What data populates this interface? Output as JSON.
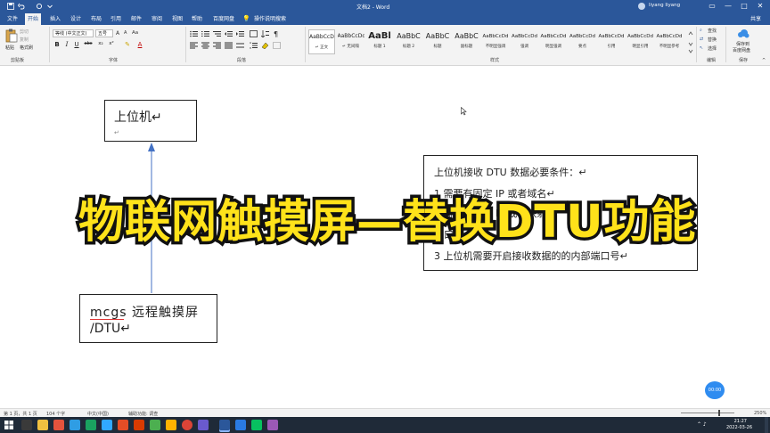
{
  "window": {
    "title": "文档2  -  Word",
    "user_name": "liyang liyang",
    "share": "共享",
    "minimize": "—",
    "maximize": "□",
    "close": "✕"
  },
  "tabs": [
    {
      "label": "文件",
      "active": false
    },
    {
      "label": "开始",
      "active": true
    },
    {
      "label": "插入",
      "active": false
    },
    {
      "label": "设计",
      "active": false
    },
    {
      "label": "布局",
      "active": false
    },
    {
      "label": "引用",
      "active": false
    },
    {
      "label": "邮件",
      "active": false
    },
    {
      "label": "审阅",
      "active": false
    },
    {
      "label": "视图",
      "active": false
    },
    {
      "label": "帮助",
      "active": false
    },
    {
      "label": "百度网盘",
      "active": false
    },
    {
      "label": "操作说明搜索",
      "active": false
    }
  ],
  "ribbon": {
    "clipboard": {
      "paste": "粘贴",
      "cut": "剪切",
      "copy": "复制",
      "format_painter": "格式刷",
      "label": "剪贴板"
    },
    "font": {
      "name": "等线 (中文正文)",
      "size": "五号",
      "bold": "B",
      "italic": "I",
      "underline": "U",
      "strike": "abc",
      "sub": "x₂",
      "sup": "x²",
      "color": "A",
      "aa": "Aa",
      "grow": "A",
      "label": "字体"
    },
    "paragraph": {
      "label": "段落"
    },
    "styles": {
      "label": "样式",
      "items": [
        {
          "sample": "AaBbCcDd",
          "name": "↵ 正文",
          "size": "6px",
          "bold": false
        },
        {
          "sample": "AaBbCcDd",
          "name": "↵ 无间隔",
          "size": "6px",
          "bold": false
        },
        {
          "sample": "AaBl",
          "name": "标题 1",
          "size": "10px",
          "bold": true
        },
        {
          "sample": "AaBbC",
          "name": "标题 2",
          "size": "8px",
          "bold": false
        },
        {
          "sample": "AaBbC",
          "name": "标题",
          "size": "8px",
          "bold": false
        },
        {
          "sample": "AaBbC",
          "name": "副标题",
          "size": "8px",
          "bold": false
        },
        {
          "sample": "AaBbCcDd",
          "name": "不明显强调",
          "size": "5.5px",
          "bold": false
        },
        {
          "sample": "AaBbCcDd",
          "name": "强调",
          "size": "5.5px",
          "bold": false
        },
        {
          "sample": "AaBbCcDd",
          "name": "明显强调",
          "size": "5.5px",
          "bold": false
        },
        {
          "sample": "AaBbCcDd",
          "name": "要点",
          "size": "5.5px",
          "bold": false
        },
        {
          "sample": "AaBbCcDd",
          "name": "引用",
          "size": "5.5px",
          "bold": false
        },
        {
          "sample": "AaBbCcDd",
          "name": "明显引用",
          "size": "5.5px",
          "bold": false
        },
        {
          "sample": "AaBbCcDd",
          "name": "不明显参考",
          "size": "5.5px",
          "bold": false
        }
      ]
    },
    "editing": {
      "find": "查找",
      "replace": "替换",
      "select": "选择",
      "label": "编辑"
    },
    "save": {
      "line1": "保存到",
      "line2": "百度网盘",
      "label": "保存"
    }
  },
  "document": {
    "box1": {
      "title": "上位机↵",
      "subline": "↵"
    },
    "box2": {
      "line1": "mcgs 远程触摸屏",
      "line2": "/DTU↵"
    },
    "box3": {
      "heading": "上位机接收 DTU 数据必要条件：↵",
      "item1": "1 需要有固定 IP 或者域名↵",
      "item2": "2 需要有公网 IP 或者映射↵",
      "item3": "端口号↵",
      "item4": "3 上位机需要开启接收数据的的内部端口号↵"
    }
  },
  "overlay": {
    "text": "物联网触摸屏—替换DTU功能"
  },
  "status": {
    "page": "第 1 页，共 1 页",
    "words": "104 个字",
    "lang": "中文(中国)",
    "access": "辅助功能: 调查",
    "zoom": "250%"
  },
  "recording_badge": "00:00",
  "clock": {
    "time": "21:27",
    "date": "2022-03-26"
  },
  "colors": {
    "accent": "#2b579a",
    "overlay_fill": "#ffe21a",
    "overlay_stroke": "#111111",
    "arrow": "#4472c4"
  }
}
